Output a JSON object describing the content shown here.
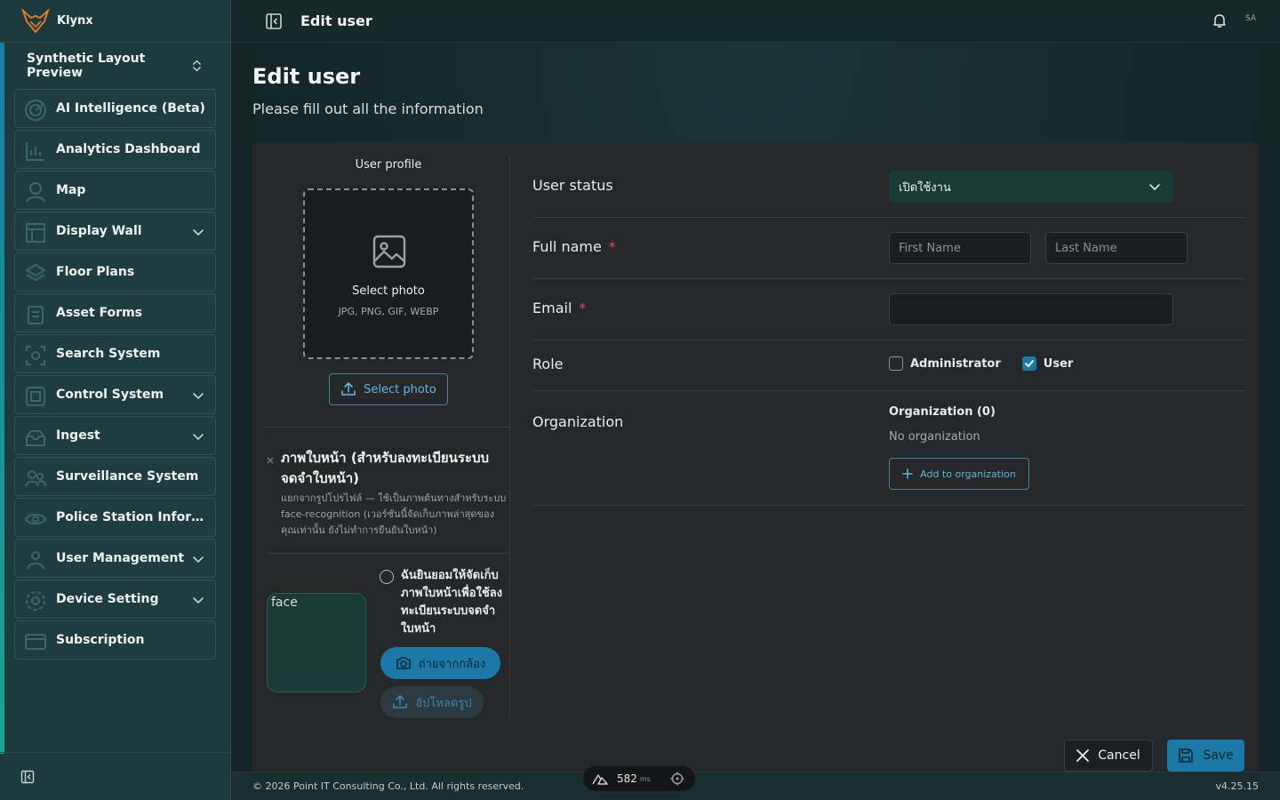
{
  "app": {
    "brand": "Klynx",
    "workspace": "Synthetic Layout Preview"
  },
  "sidebar": {
    "items": [
      {
        "label": "AI Intelligence (Beta)",
        "icon": "radar-icon",
        "expandable": false
      },
      {
        "label": "Analytics Dashboard",
        "icon": "chart-icon",
        "expandable": false
      },
      {
        "label": "Map",
        "icon": "map-pin-icon",
        "expandable": false
      },
      {
        "label": "Display Wall",
        "icon": "layout-icon",
        "expandable": true
      },
      {
        "label": "Floor Plans",
        "icon": "layers-icon",
        "expandable": false
      },
      {
        "label": "Asset Forms",
        "icon": "clipboard-icon",
        "expandable": false
      },
      {
        "label": "Search System",
        "icon": "scan-icon",
        "expandable": false
      },
      {
        "label": "Control System",
        "icon": "control-icon",
        "expandable": true
      },
      {
        "label": "Ingest",
        "icon": "ingest-icon",
        "expandable": true
      },
      {
        "label": "Surveillance System",
        "icon": "users-icon",
        "expandable": false
      },
      {
        "label": "Police Station Informati...",
        "icon": "eye-icon",
        "expandable": false
      },
      {
        "label": "User Management",
        "icon": "user-group-icon",
        "expandable": true
      },
      {
        "label": "Device Setting",
        "icon": "gear-icon",
        "expandable": true
      },
      {
        "label": "Subscription",
        "icon": "card-icon",
        "expandable": false
      }
    ]
  },
  "header": {
    "title": "Edit user",
    "avatar": "SA"
  },
  "page": {
    "title": "Edit user",
    "subtitle": "Please fill out all the information"
  },
  "profile": {
    "label": "User profile",
    "dropzone_title": "Select photo",
    "dropzone_types": "JPG, PNG, GIF, WEBP",
    "select_button": "Select photo"
  },
  "face": {
    "title": "ภาพใบหน้า (สำหรับลงทะเบียนระบบจดจำใบหน้า)",
    "description": "แยกจากรูปโปรไฟล์ — ใช้เป็นภาพต้นทางสำหรับระบบ face-recognition (เวอร์ชันนี้จัดเก็บภาพล่าสุดของคุณเท่านั้น ยังไม่ทำการยืนยันใบหน้า)",
    "image_alt": "face",
    "consent": "ฉันยินยอมให้จัดเก็บภาพใบหน้าเพื่อใช้ลงทะเบียนระบบจดจำใบหน้า",
    "consent_checked": false,
    "camera_button": "ถ่ายจากกล้อง",
    "upload_button": "อัปโหลดรูป"
  },
  "form": {
    "status": {
      "label": "User status",
      "value": "เปิดใช้งาน"
    },
    "fullname": {
      "label": "Full name",
      "required": "*",
      "first_placeholder": "First Name",
      "last_placeholder": "Last Name"
    },
    "email": {
      "label": "Email",
      "required": "*",
      "value": ""
    },
    "role": {
      "label": "Role",
      "options": [
        {
          "label": "Administrator",
          "checked": false
        },
        {
          "label": "User",
          "checked": true
        }
      ]
    },
    "organization": {
      "label": "Organization",
      "title": "Organization (0)",
      "empty": "No organization",
      "add_button": "Add to organization"
    }
  },
  "actions": {
    "cancel": "Cancel",
    "save": "Save"
  },
  "footer": {
    "copyright": "© 2026 Point IT Consulting Co., Ltd. All rights reserved.",
    "version": "v4.25.15"
  },
  "perf": {
    "value": "582",
    "unit": "ms"
  },
  "colors": {
    "accent": "#1c78a7",
    "sidebar_bg": "#1d3a3d",
    "required": "#e0456a"
  }
}
